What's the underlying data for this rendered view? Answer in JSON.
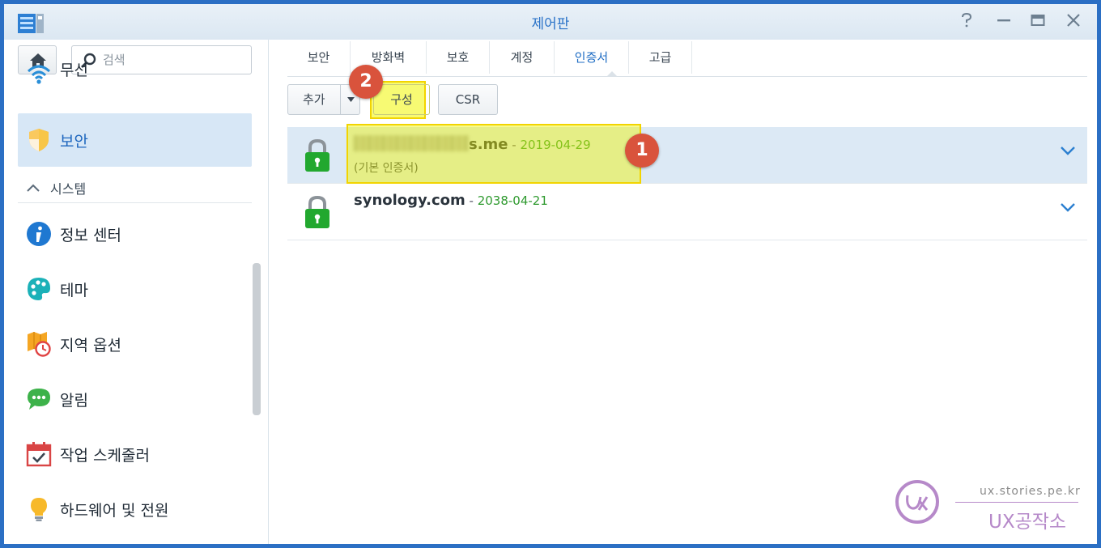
{
  "window": {
    "title": "제어판"
  },
  "sidebar": {
    "search_placeholder": "검색",
    "items": [
      {
        "label": "무선",
        "icon": "wifi-icon"
      },
      {
        "label": "보안",
        "icon": "shield-icon",
        "active": true
      }
    ],
    "section": {
      "label": "시스템",
      "icon": "chevron-up-icon"
    },
    "system_items": [
      {
        "label": "정보 센터",
        "icon": "info-icon"
      },
      {
        "label": "테마",
        "icon": "palette-icon"
      },
      {
        "label": "지역 옵션",
        "icon": "map-clock-icon"
      },
      {
        "label": "알림",
        "icon": "chat-bubble-icon"
      },
      {
        "label": "작업 스케줄러",
        "icon": "calendar-check-icon"
      },
      {
        "label": "하드웨어 및 전원",
        "icon": "lightbulb-icon"
      }
    ]
  },
  "tabs": [
    "보안",
    "방화벽",
    "보호",
    "계정",
    "인증서",
    "고급"
  ],
  "active_tab": "인증서",
  "toolbar": {
    "add_label": "추가",
    "configure_label": "구성",
    "csr_label": "CSR"
  },
  "certificates": [
    {
      "name": "s.me",
      "separator": " - ",
      "date": "2019-04-29",
      "subtitle": "(기본 인증서)",
      "selected": true
    },
    {
      "name": "synology.com",
      "separator": " - ",
      "date": "2038-04-21",
      "subtitle": "",
      "selected": false
    }
  ],
  "annotations": {
    "step1": "1",
    "step2": "2"
  },
  "watermark": {
    "url": "ux.stories.pe.kr",
    "name": "UX공작소"
  },
  "colors": {
    "accent": "#2b73c8",
    "selection": "#dce9f5",
    "date_green": "#2f9a2f",
    "highlight": "#f0f500",
    "badge": "#d9533c"
  }
}
